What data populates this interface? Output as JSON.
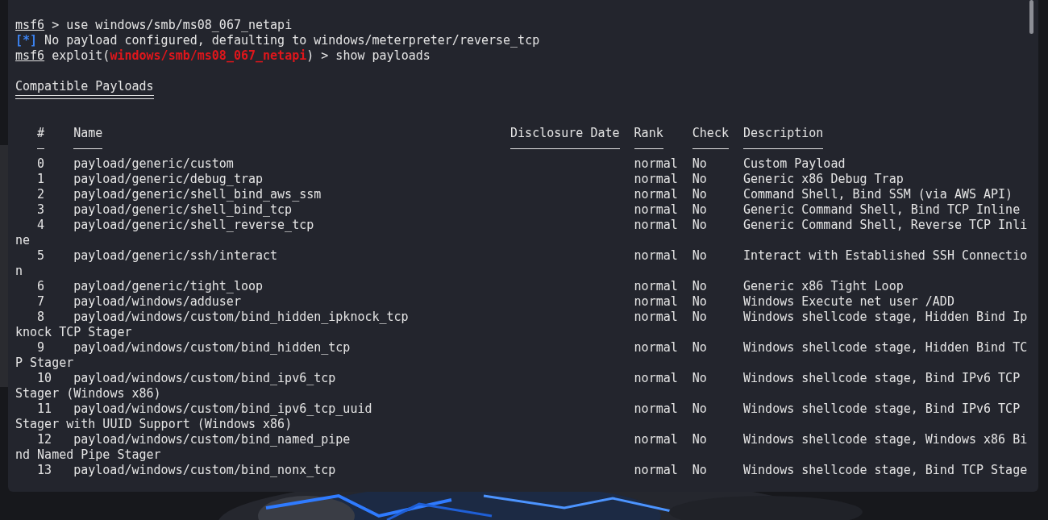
{
  "terminal": {
    "lines": [
      {
        "kind": "prompt",
        "prompt": "msf6",
        "text": " > use windows/smb/ms08_067_netapi"
      },
      {
        "kind": "status",
        "marker": "[*]",
        "text": " No payload configured, defaulting to windows/meterpreter/reverse_tcp"
      },
      {
        "kind": "module_prompt",
        "prompt": "msf6",
        "context": " exploit(",
        "module": "windows/smb/ms08_067_netapi",
        "text": ") > show payloads"
      }
    ],
    "section_title": "Compatible Payloads",
    "table": {
      "columns": [
        "#",
        "Name",
        "Disclosure Date",
        "Rank",
        "Check",
        "Description"
      ],
      "rows": [
        {
          "number": "0",
          "name": "payload/generic/custom",
          "rank": "normal",
          "check": "No",
          "description": "Custom Payload"
        },
        {
          "number": "1",
          "name": "payload/generic/debug_trap",
          "rank": "normal",
          "check": "No",
          "description": "Generic x86 Debug Trap"
        },
        {
          "number": "2",
          "name": "payload/generic/shell_bind_aws_ssm",
          "rank": "normal",
          "check": "No",
          "description": "Command Shell, Bind SSM (via AWS API)"
        },
        {
          "number": "3",
          "name": "payload/generic/shell_bind_tcp",
          "rank": "normal",
          "check": "No",
          "description": "Generic Command Shell, Bind TCP Inline"
        },
        {
          "number": "4",
          "name": "payload/generic/shell_reverse_tcp",
          "rank": "normal",
          "check": "No",
          "description": "Generic Command Shell, Reverse TCP Inli",
          "wrapped": "ne"
        },
        {
          "number": "5",
          "name": "payload/generic/ssh/interact",
          "rank": "normal",
          "check": "No",
          "description": "Interact with Established SSH Connectio",
          "wrapped": "n"
        },
        {
          "number": "6",
          "name": "payload/generic/tight_loop",
          "rank": "normal",
          "check": "No",
          "description": "Generic x86 Tight Loop"
        },
        {
          "number": "7",
          "name": "payload/windows/adduser",
          "rank": "normal",
          "check": "No",
          "description": "Windows Execute net user /ADD"
        },
        {
          "number": "8",
          "name": "payload/windows/custom/bind_hidden_ipknock_tcp",
          "rank": "normal",
          "check": "No",
          "description": "Windows shellcode stage, Hidden Bind Ip",
          "wrapped": "knock TCP Stager"
        },
        {
          "number": "9",
          "name": "payload/windows/custom/bind_hidden_tcp",
          "rank": "normal",
          "check": "No",
          "description": "Windows shellcode stage, Hidden Bind TC",
          "wrapped": "P Stager"
        },
        {
          "number": "10",
          "name": "payload/windows/custom/bind_ipv6_tcp",
          "rank": "normal",
          "check": "No",
          "description": "Windows shellcode stage, Bind IPv6 TCP",
          "wrapped": "Stager (Windows x86)"
        },
        {
          "number": "11",
          "name": "payload/windows/custom/bind_ipv6_tcp_uuid",
          "rank": "normal",
          "check": "No",
          "description": "Windows shellcode stage, Bind IPv6 TCP",
          "wrapped": "Stager with UUID Support (Windows x86)"
        },
        {
          "number": "12",
          "name": "payload/windows/custom/bind_named_pipe",
          "rank": "normal",
          "check": "No",
          "description": "Windows shellcode stage, Windows x86 Bi",
          "wrapped": "nd Named Pipe Stager"
        },
        {
          "number": "13",
          "name": "payload/windows/custom/bind_nonx_tcp",
          "rank": "normal",
          "check": "No",
          "description": "Windows shellcode stage, Bind TCP Stage"
        }
      ]
    }
  }
}
